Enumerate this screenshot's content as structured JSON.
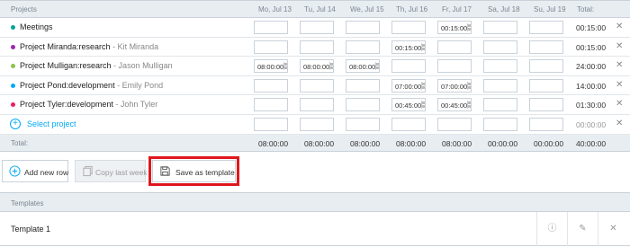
{
  "header": {
    "projects": "Projects",
    "days": [
      "Mo, Jul 13",
      "Tu, Jul 14",
      "We, Jul 15",
      "Th, Jul 16",
      "Fr, Jul 17",
      "Sa, Jul 18",
      "Su, Jul 19"
    ],
    "total": "Total:"
  },
  "rows": [
    {
      "project": "Meetings",
      "client": "",
      "color": "#00a39a",
      "entries": [
        "",
        "",
        "",
        "",
        "00:15:00",
        "",
        ""
      ],
      "total": "00:15:00"
    },
    {
      "project": "Project Miranda:research",
      "client": "-  Kit Miranda",
      "color": "#9c27b0",
      "entries": [
        "",
        "",
        "",
        "00:15:00",
        "",
        "",
        ""
      ],
      "total": "00:15:00"
    },
    {
      "project": "Project Mulligan:research",
      "client": "-  Jason Mulligan",
      "color": "#8bc34a",
      "entries": [
        "08:00:00",
        "08:00:00",
        "08:00:00",
        "",
        "",
        "",
        ""
      ],
      "total": "24:00:00"
    },
    {
      "project": "Project Pond:development",
      "client": "-  Emily Pond",
      "color": "#03a9f4",
      "entries": [
        "",
        "",
        "",
        "07:00:00",
        "07:00:00",
        "",
        ""
      ],
      "total": "14:00:00"
    },
    {
      "project": "Project Tyler:development",
      "client": "-  John Tyler",
      "color": "#e91e63",
      "entries": [
        "",
        "",
        "",
        "00:45:00",
        "00:45:00",
        "",
        ""
      ],
      "total": "01:30:00"
    }
  ],
  "select_row": {
    "label": "Select project",
    "total": "00:00:00"
  },
  "footer": {
    "label": "Total:",
    "totals": [
      "08:00:00",
      "08:00:00",
      "08:00:00",
      "08:00:00",
      "08:00:00",
      "00:00:00",
      "00:00:00"
    ],
    "grand_total": "40:00:00"
  },
  "actions": {
    "add_row": "Add new row",
    "copy_last_week": "Copy last week",
    "save_template": "Save as template"
  },
  "templates": {
    "heading": "Templates",
    "items": [
      {
        "name": "Template 1"
      }
    ]
  },
  "icons": {
    "delete": "close-icon",
    "info": "info-icon",
    "edit": "pencil-icon",
    "add": "plus-circle-icon",
    "copy": "copy-icon",
    "save": "floppy-icon"
  }
}
